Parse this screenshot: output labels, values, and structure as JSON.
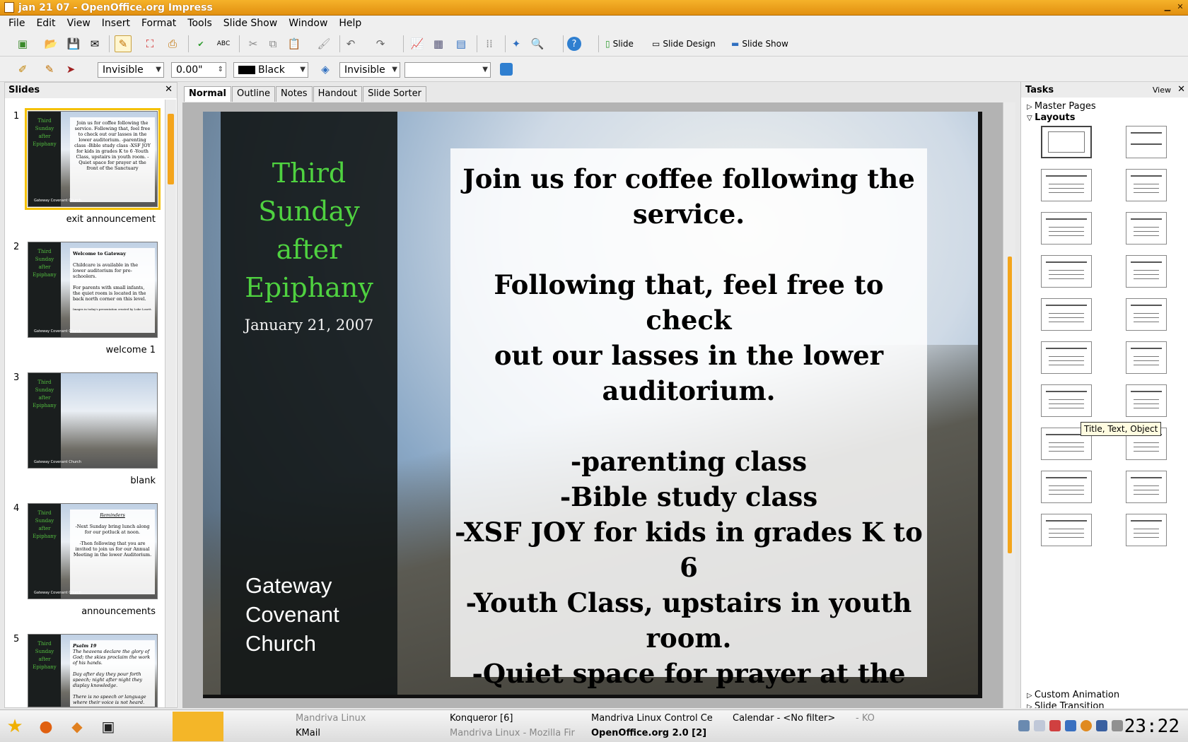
{
  "window": {
    "title": "jan 21 07 - OpenOffice.org Impress"
  },
  "menu": [
    "File",
    "Edit",
    "View",
    "Insert",
    "Format",
    "Tools",
    "Slide Show",
    "Window",
    "Help"
  ],
  "toolbar": {
    "slide_label": "Slide",
    "slide_design_label": "Slide Design",
    "slide_show_label": "Slide Show"
  },
  "format_bar": {
    "area_style": "Invisible",
    "line_width": "0.00\"",
    "line_color": "Black",
    "shadow_style": "Invisible",
    "extra_select": ""
  },
  "slides_panel": {
    "title": "Slides",
    "slides": [
      {
        "number": "1",
        "name": "exit announcement"
      },
      {
        "number": "2",
        "name": "welcome 1"
      },
      {
        "number": "3",
        "name": "blank"
      },
      {
        "number": "4",
        "name": "announcements"
      },
      {
        "number": "5",
        "name": ""
      }
    ],
    "thumb_text": {
      "title": "Third Sunday after Epiphany",
      "date": "January 21, 2007",
      "church": "Gateway Covenant Church",
      "s1": "Join us for coffee following the service. Following that, feel free to check out our lasses in the lower auditorium. -parenting class -Bible study class -XSF JOY for kids in grades K to 6 -Youth Class, upstairs in youth room. -Quiet space for prayer at the front of the Sanctuary",
      "s2a": "Welcome to Gateway",
      "s2b": "Childcare is available in the lower auditorium for pre-schoolers.",
      "s2c": "For parents with small infants, the quiet room is located in the back north corner on this level.",
      "s2d": "Images in today's presentation created by Luke Losett.",
      "s4a": "Reminders",
      "s4b": "-Next Sunday bring lunch along for our potluck at noon.",
      "s4c": "-Then following that you are invited to join us for our Annual Meeting in the lower Auditorium.",
      "s5a": "Psalm 19",
      "s5b": "The heavens declare the glory of God; the skies proclaim the work of his hands.",
      "s5c": "Day after day they pour forth speech; night after night they display knowledge.",
      "s5d": "There is no speech or language where their voice is not heard."
    }
  },
  "view_tabs": [
    "Normal",
    "Outline",
    "Notes",
    "Handout",
    "Slide Sorter"
  ],
  "slide": {
    "title_lines": [
      "Third",
      "Sunday",
      "after",
      "Epiphany"
    ],
    "date": "January 21, 2007",
    "church_lines": [
      "Gateway",
      "Covenant",
      "Church"
    ],
    "body": {
      "p1": [
        "Join us for coffee following the",
        "service."
      ],
      "p2": [
        "Following that, feel free to check",
        "out our lasses in the lower",
        "auditorium."
      ],
      "items": [
        "-parenting class",
        "-Bible study class",
        "-XSF JOY for kids in grades K to 6",
        "-Youth Class, upstairs in youth",
        "room.",
        "-Quiet space for prayer at the",
        "front of the Sanctuary"
      ]
    }
  },
  "tasks": {
    "title": "Tasks",
    "view_label": "View",
    "master_pages": "Master Pages",
    "layouts": "Layouts",
    "custom_animation": "Custom Animation",
    "slide_transition": "Slide Transition",
    "tooltip": "Title, Text, Object"
  },
  "taskbar": {
    "items": [
      "Mandriva Linux",
      "KMail",
      "Konqueror [6]",
      "Mandriva Linux - Mozilla Fir",
      "Mandriva Linux Control Ce",
      "OpenOffice.org 2.0 [2]",
      "Calendar - <No filter>",
      "- KO"
    ],
    "clock": "23:22"
  },
  "colors": {
    "accent": "#f4a51c",
    "slide_title": "#4fd240"
  }
}
